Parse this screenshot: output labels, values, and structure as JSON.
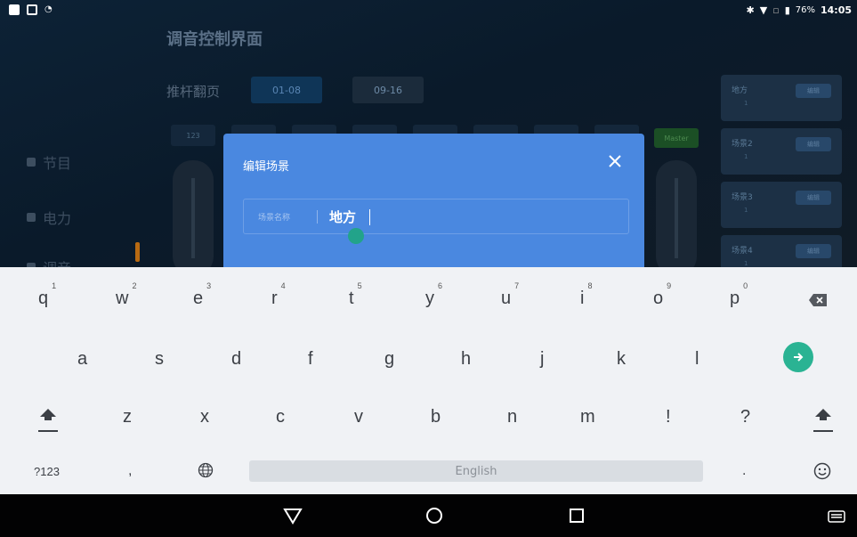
{
  "status_bar": {
    "battery": "76%",
    "time": "14:05"
  },
  "app": {
    "title": "调音控制界面",
    "fader_page_label": "推杆翻页",
    "pages": [
      "01-08",
      "09-16"
    ],
    "sidebar": [
      {
        "label": "节目"
      },
      {
        "label": "电力"
      },
      {
        "label": "调音"
      }
    ],
    "channel_first_label": "123",
    "master_label": "Master",
    "scenes": [
      {
        "name": "地方",
        "sub": "1",
        "edit": "编辑"
      },
      {
        "name": "场景2",
        "sub": "1",
        "edit": "编辑"
      },
      {
        "name": "场景3",
        "sub": "1",
        "edit": "编辑"
      },
      {
        "name": "场景4",
        "sub": "1",
        "edit": "编辑"
      }
    ]
  },
  "dialog": {
    "title": "编辑场景",
    "field_label": "场景名称",
    "field_value": "地方"
  },
  "keyboard": {
    "row1": [
      {
        "key": "q",
        "hint": "1"
      },
      {
        "key": "w",
        "hint": "2"
      },
      {
        "key": "e",
        "hint": "3"
      },
      {
        "key": "r",
        "hint": "4"
      },
      {
        "key": "t",
        "hint": "5"
      },
      {
        "key": "y",
        "hint": "6"
      },
      {
        "key": "u",
        "hint": "7"
      },
      {
        "key": "i",
        "hint": "8"
      },
      {
        "key": "o",
        "hint": "9"
      },
      {
        "key": "p",
        "hint": "0"
      }
    ],
    "row2": [
      "a",
      "s",
      "d",
      "f",
      "g",
      "h",
      "j",
      "k",
      "l"
    ],
    "row3": [
      "z",
      "x",
      "c",
      "v",
      "b",
      "n",
      "m",
      "!",
      "?"
    ],
    "symbols_key": "?123",
    "comma_key": ",",
    "space_label": "English",
    "period_key": ".",
    "accent_color": "#2ab393"
  }
}
